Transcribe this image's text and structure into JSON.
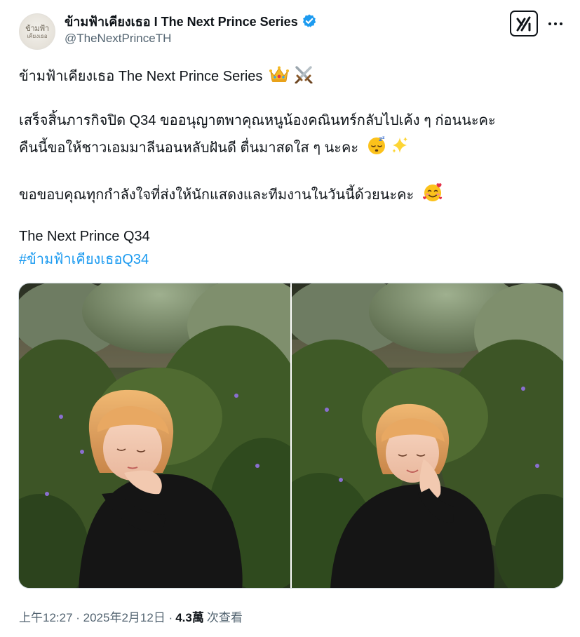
{
  "header": {
    "display_name": "ข้ามฟ้าเคียงเธอ I The Next Prince Series",
    "handle": "@TheNextPrinceTH",
    "avatar_logo_line1": "ข้ามฟ้า",
    "avatar_logo_line2": "เคียงเธอ",
    "verified": true,
    "verified_color": "#1d9bf0"
  },
  "tweet": {
    "line1": "ข้ามฟ้าเคียงเธอ The Next Prince Series",
    "line2": "เสร็จสิ้นภารกิจปิด Q34 ขออนุญาตพาคุณหนูน้องคณินทร์กลับไปเค้ง ๆ ก่อนนะคะ",
    "line3": "คืนนี้ขอให้ชาวเอมมาลีนอนหลับฝันดี ตื่นมาสดใส ๆ นะคะ",
    "line4": "ขอขอบคุณทุกกำลังใจที่ส่งให้นักแสดงและทีมงานในวันนี้ด้วยนะคะ",
    "line5": "The Next Prince Q34",
    "hashtag": "#ข้ามฟ้าเคียงเธอQ34",
    "hashtag_color": "#1d9bf0",
    "emojis": [
      "crown-emoji",
      "crossed-swords-emoji",
      "sleeping-face-emoji",
      "sparkles-emoji",
      "smiling-face-with-hearts-emoji"
    ]
  },
  "media": {
    "photos": [
      "photo-1",
      "photo-2"
    ]
  },
  "footer": {
    "timestamp": "上午12:27 · 2025年2月12日 · ",
    "views_count": "4.3萬",
    "views_label": "次查看"
  }
}
